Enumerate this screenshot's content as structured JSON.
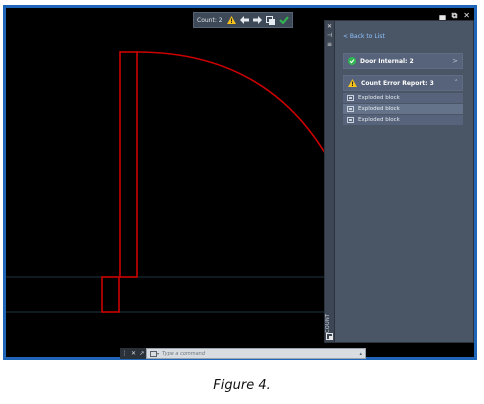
{
  "toolbar": {
    "count_label": "Count: 2"
  },
  "window": {
    "minimize": "▄",
    "restore": "⧉",
    "close": "✕"
  },
  "palette": {
    "strip_close": "✕",
    "strip_pin": "⊣",
    "strip_props": "≡",
    "side_title": "COUNT",
    "back_link": "< Back to List",
    "door_card": {
      "title": "Door Internal: 2",
      "chevron": ">"
    },
    "error_card": {
      "title": "Count Error Report: 3",
      "chevron": "˄"
    },
    "items": [
      {
        "label": "Exploded block"
      },
      {
        "label": "Exploded block"
      },
      {
        "label": "Exploded block"
      }
    ]
  },
  "command_line": {
    "close": "✕",
    "tool": "↗",
    "placeholder": "Type a command",
    "dropdown": "▴"
  },
  "colors": {
    "accent_blue": "#1f66b8",
    "door_red": "#cc0000",
    "ok_green": "#2fb84f",
    "warn_yellow": "#f4c21b"
  },
  "caption": "Figure 4."
}
